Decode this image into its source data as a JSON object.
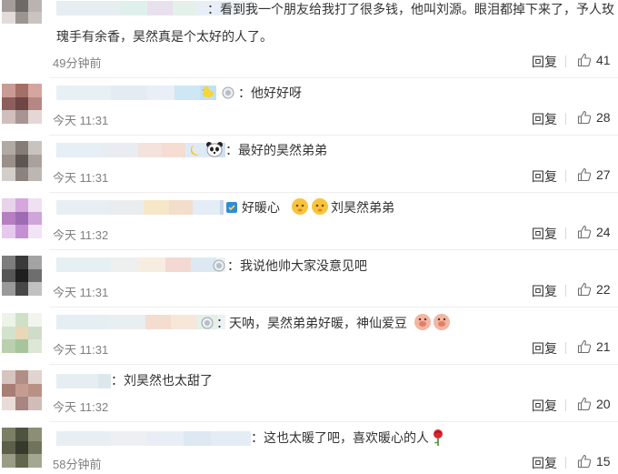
{
  "comments": [
    {
      "text_line1": "：看到我一个朋友给我打了很多钱，他叫刘源。眼泪都掉下来了，予人玫",
      "text_line2": "瑰手有余香，昊然真是个太好的人了。",
      "time": "49分钟前",
      "reply": "回复",
      "likes": "41"
    },
    {
      "text": "：他好好呀",
      "time": "今天 11:31",
      "reply": "回复",
      "likes": "28"
    },
    {
      "text": "：最好的昊然弟弟",
      "time": "今天 11:31",
      "reply": "回复",
      "likes": "27"
    },
    {
      "text_a": "好暖心",
      "text_b": "刘昊然弟弟",
      "time": "今天 11:32",
      "reply": "回复",
      "likes": "24"
    },
    {
      "text": "：我说他帅大家没意见吧",
      "time": "今天 11:31",
      "reply": "回复",
      "likes": "22"
    },
    {
      "text_a": "：天呐，昊然弟弟好暖，神仙爱豆",
      "time": "今天 11:31",
      "reply": "回复",
      "likes": "21"
    },
    {
      "text": "：刘昊然也太甜了",
      "time": "今天 11:32",
      "reply": "回复",
      "likes": "20"
    },
    {
      "text": "：这也太暖了吧，喜欢暖心的人",
      "time": "58分钟前",
      "reply": "回复",
      "likes": "15"
    }
  ],
  "icons": {
    "like": "thumbs-up-icon",
    "flower": "rose-icon",
    "badge": "medal-badge-icon",
    "emoji": "emoji-icon"
  },
  "colors": {
    "text": "#333333",
    "time": "#808080",
    "divider": "#eeeeee"
  }
}
